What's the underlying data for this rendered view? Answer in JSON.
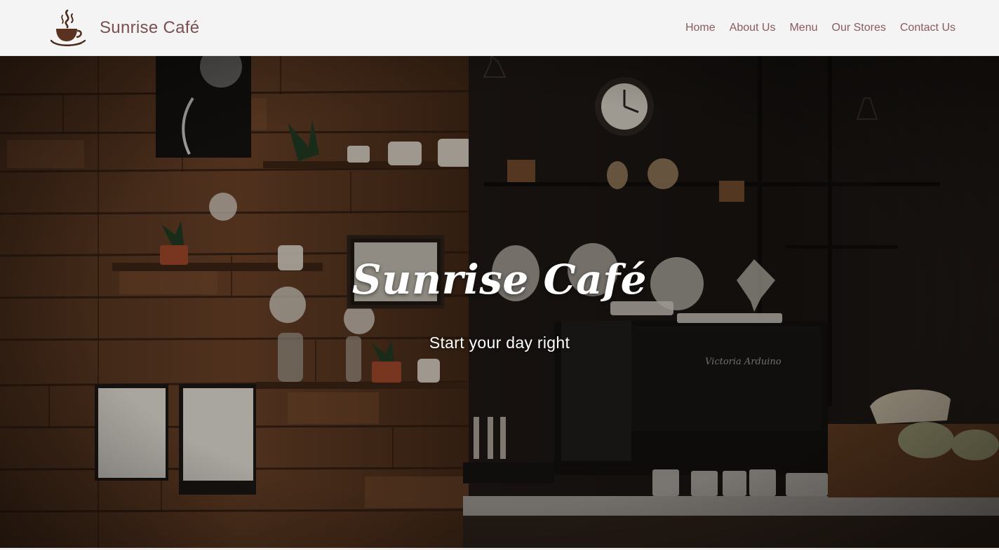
{
  "brand": {
    "name": "Sunrise Café",
    "logo_icon": "coffee-cup-icon",
    "color": "#7b4e52"
  },
  "nav": {
    "items": [
      {
        "label": "Home"
      },
      {
        "label": "About Us"
      },
      {
        "label": "Menu"
      },
      {
        "label": "Our Stores"
      },
      {
        "label": "Contact Us"
      }
    ],
    "color": "#8b5a5e"
  },
  "hero": {
    "title": "Sunrise Café",
    "tagline": "Start your day right"
  },
  "colors": {
    "navbar_bg": "#f5f4f4",
    "hero_text": "#ffffff"
  }
}
